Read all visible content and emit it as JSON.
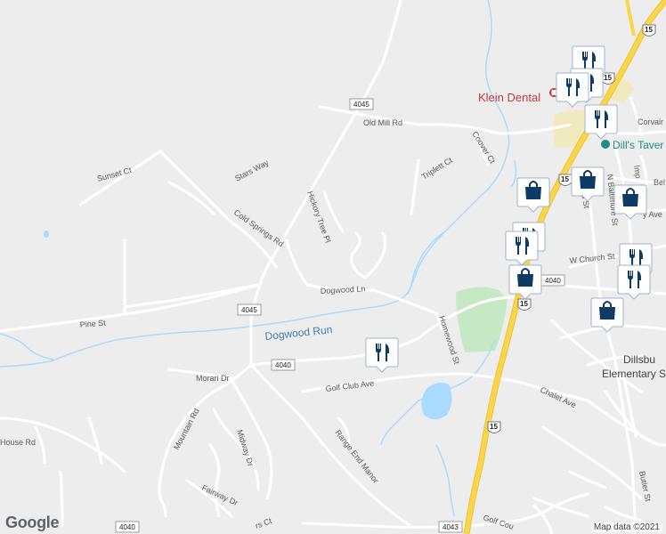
{
  "map": {
    "roads": {
      "old_mill": "Old Mill Rd",
      "hickory": "Hickory Tree Pl",
      "stars": "Stars Way",
      "sunset": "Sunset Ct",
      "cold_springs": "Cold Springs Rd",
      "dogwood": "Dogwood Ln",
      "pine": "Pine St",
      "golf_club": "Golf Club Ave",
      "morari": "Morari Dr",
      "mountain": "Mountain Rd",
      "midway": "Midway Dr",
      "fairway": "Fairway Dr",
      "range_end": "Range End Manor",
      "house": "House Rd",
      "homewood": "Homewood St",
      "chalet": "Chalet Ave",
      "coover": "Coover Ct",
      "triplett": "Triplett Ct",
      "w_church": "W Church St",
      "n_baltimore": "N Baltimore St",
      "second": "N 2nd St",
      "butler": "Butler St",
      "golf_course": "Golf Cou",
      "corvair": "Corvair D",
      "imperial": "Imp",
      "beltway": "Bel",
      "ave_fragment": "y Ave",
      "courts": "rs Ct"
    },
    "water": {
      "dogwood_run": "Dogwood Run"
    },
    "shields": {
      "s4045_top": "4045",
      "s4045_mid": "4045",
      "s4040_left": "4040",
      "s4040_right": "4040",
      "s4040_bottom": "4040",
      "s4043": "4043",
      "us15_a": "15",
      "us15_b": "15",
      "us15_c": "15",
      "us15_d": "15"
    },
    "pois": {
      "klein_dental": "Klein Dental",
      "dills_tavern": "Dill's Taver",
      "dillsburg": "Dillsbu",
      "elementary": "Elementary Scho",
      "town_fragment": "D"
    },
    "markers": [
      {
        "kind": "restaurant",
        "icon": "fork-knife-icon"
      },
      {
        "kind": "restaurant",
        "icon": "fork-knife-icon"
      },
      {
        "kind": "restaurant",
        "icon": "fork-knife-icon"
      },
      {
        "kind": "restaurant",
        "icon": "fork-knife-icon"
      },
      {
        "kind": "shopping",
        "icon": "shopping-bag-icon"
      },
      {
        "kind": "shopping",
        "icon": "shopping-bag-icon"
      },
      {
        "kind": "shopping",
        "icon": "shopping-bag-icon"
      },
      {
        "kind": "restaurant",
        "icon": "fork-knife-icon"
      },
      {
        "kind": "restaurant",
        "icon": "fork-knife-icon"
      },
      {
        "kind": "shopping",
        "icon": "shopping-bag-icon"
      },
      {
        "kind": "restaurant",
        "icon": "fork-knife-icon"
      },
      {
        "kind": "restaurant",
        "icon": "fork-knife-icon"
      },
      {
        "kind": "shopping",
        "icon": "shopping-bag-icon"
      },
      {
        "kind": "restaurant",
        "icon": "fork-knife-icon"
      }
    ],
    "colors": {
      "background": "#ededed",
      "road": "#ffffff",
      "highway": "#f7d64a",
      "water": "#aadaff",
      "park": "#c7e8c4",
      "marker_fill": "#0d3b66"
    }
  },
  "attribution": "Map data ©2021",
  "logo": "Google"
}
